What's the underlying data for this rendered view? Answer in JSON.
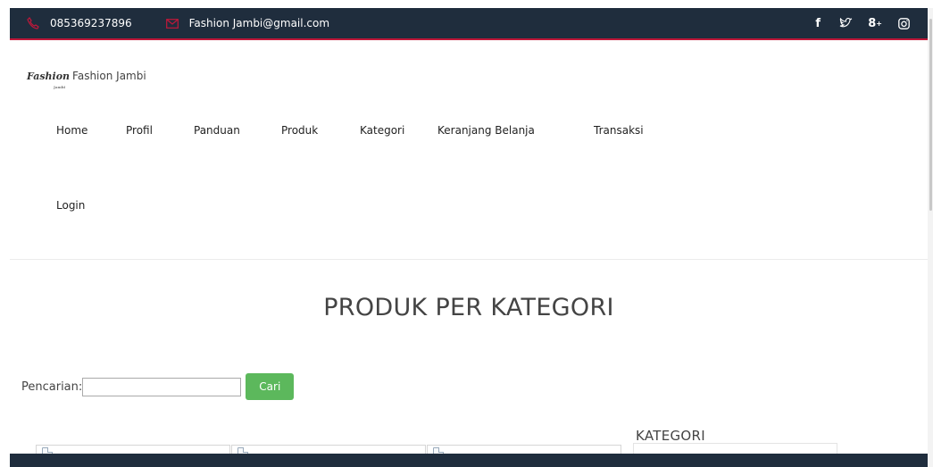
{
  "topbar": {
    "phone": "085369237896",
    "email": "Fashion Jambi@gmail.com",
    "icons": [
      "phone-icon",
      "mail-icon"
    ],
    "social": [
      "f",
      "twitter-icon",
      "g+",
      "instagram-icon"
    ],
    "colors": {
      "background": "#1f2d3d",
      "accent": "#c0183a"
    }
  },
  "logo": {
    "script": "Fashion",
    "tagline": "Jambi",
    "name": "Fashion Jambi"
  },
  "nav": {
    "items": [
      "Home",
      "Profil",
      "Panduan",
      "Produk",
      "Kategori",
      "Keranjang Belanja",
      "Transaksi"
    ],
    "login": "Login"
  },
  "main": {
    "title": "PRODUK PER KATEGORI",
    "search": {
      "label": "Pencarian:",
      "value": "",
      "placeholder": "",
      "button": "Cari",
      "button_color": "#5cb85c"
    }
  },
  "sidebar": {
    "title": "KATEGORI"
  }
}
